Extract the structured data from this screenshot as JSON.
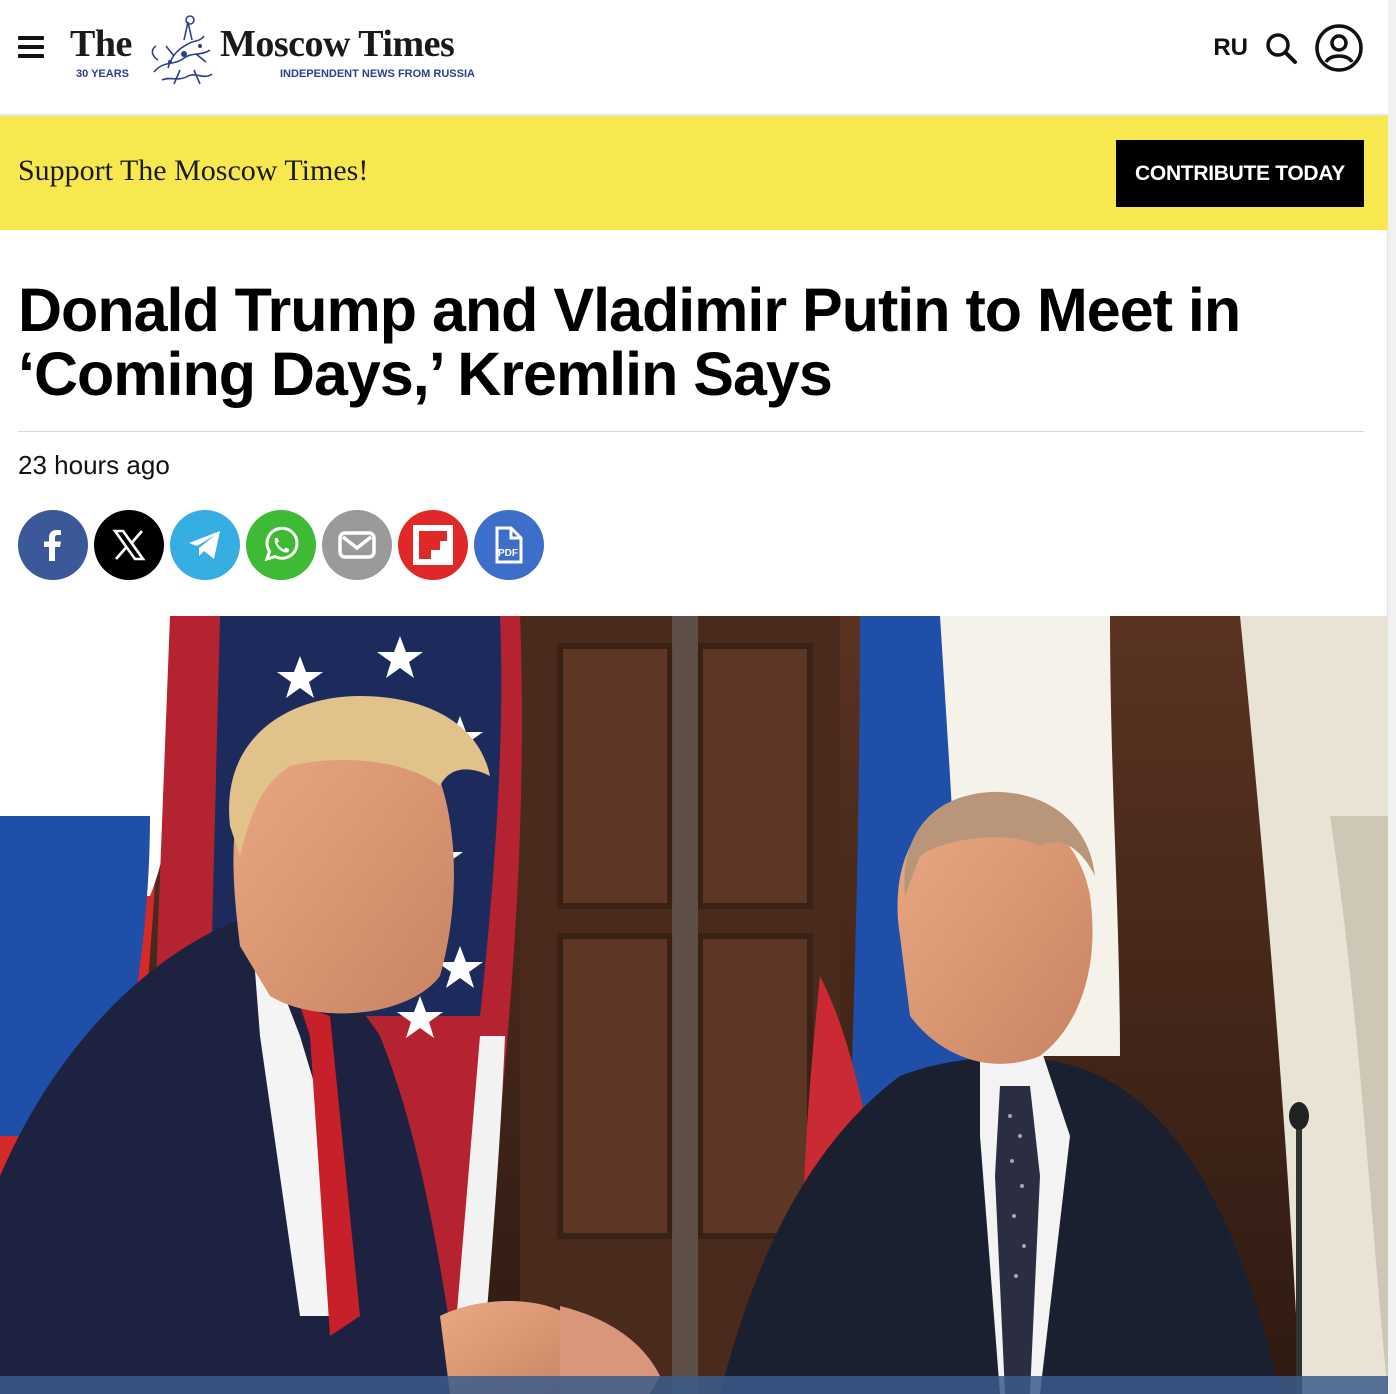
{
  "header": {
    "logo_the": "The",
    "logo_name": "Moscow Times",
    "logo_years": "30 YEARS",
    "logo_tagline": "INDEPENDENT NEWS FROM RUSSIA",
    "lang_label": "RU",
    "icons": [
      "menu-icon",
      "search-icon",
      "user-account-icon"
    ]
  },
  "banner": {
    "text": "Support The Moscow Times!",
    "button_label": "CONTRIBUTE TODAY",
    "background": "#f6e84e"
  },
  "article": {
    "headline": "Donald Trump and Vladimir Putin to Meet in ‘Coming Days,’ Kremlin Says",
    "timestamp": "23 hours ago"
  },
  "share": [
    {
      "icon": "facebook-icon",
      "color": "#3b5998"
    },
    {
      "icon": "x-icon",
      "color": "#000000"
    },
    {
      "icon": "telegram-icon",
      "color": "#37aee2"
    },
    {
      "icon": "whatsapp-icon",
      "color": "#3fba35"
    },
    {
      "icon": "email-icon",
      "color": "#9a9a9a"
    },
    {
      "icon": "flipboard-icon",
      "color": "#e12828"
    },
    {
      "icon": "pdf-icon",
      "color": "#3d6ec9",
      "label": "PDF"
    }
  ]
}
